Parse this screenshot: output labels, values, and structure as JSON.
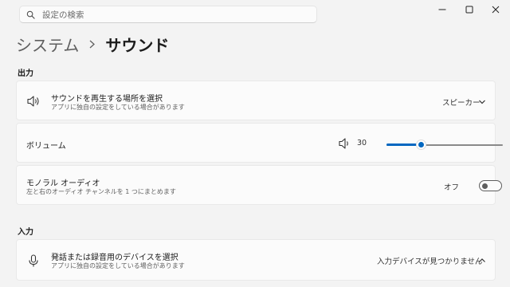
{
  "search": {
    "placeholder": "設定の検索"
  },
  "breadcrumb": {
    "parent": "システム",
    "current": "サウンド"
  },
  "output": {
    "label": "出力",
    "device_card": {
      "title": "サウンドを再生する場所を選択",
      "description": "アプリに独自の設定をしている場合があります",
      "value": "スピーカー"
    },
    "volume_card": {
      "title": "ボリューム",
      "value": "30",
      "level": 0.3
    },
    "mono_card": {
      "title": "モノラル オーディオ",
      "description": "左と右のオーディオ チャンネルを 1 つにまとめます",
      "state": "オフ"
    }
  },
  "input": {
    "label": "入力",
    "device_card": {
      "title": "発話または録音用のデバイスを選択",
      "description": "アプリに独自の設定をしている場合があります",
      "value": "入力デバイスが見つかりません"
    }
  },
  "colors": {
    "accent": "#0067c0",
    "background": "#f3f3f3",
    "card": "#fbfbfb"
  },
  "icons": [
    "search-icon",
    "minimize-icon",
    "maximize-icon",
    "close-icon",
    "chevron-right-icon",
    "speaker-icon",
    "volume-icon",
    "microphone-icon",
    "chevron-down-icon",
    "chevron-up-icon"
  ]
}
